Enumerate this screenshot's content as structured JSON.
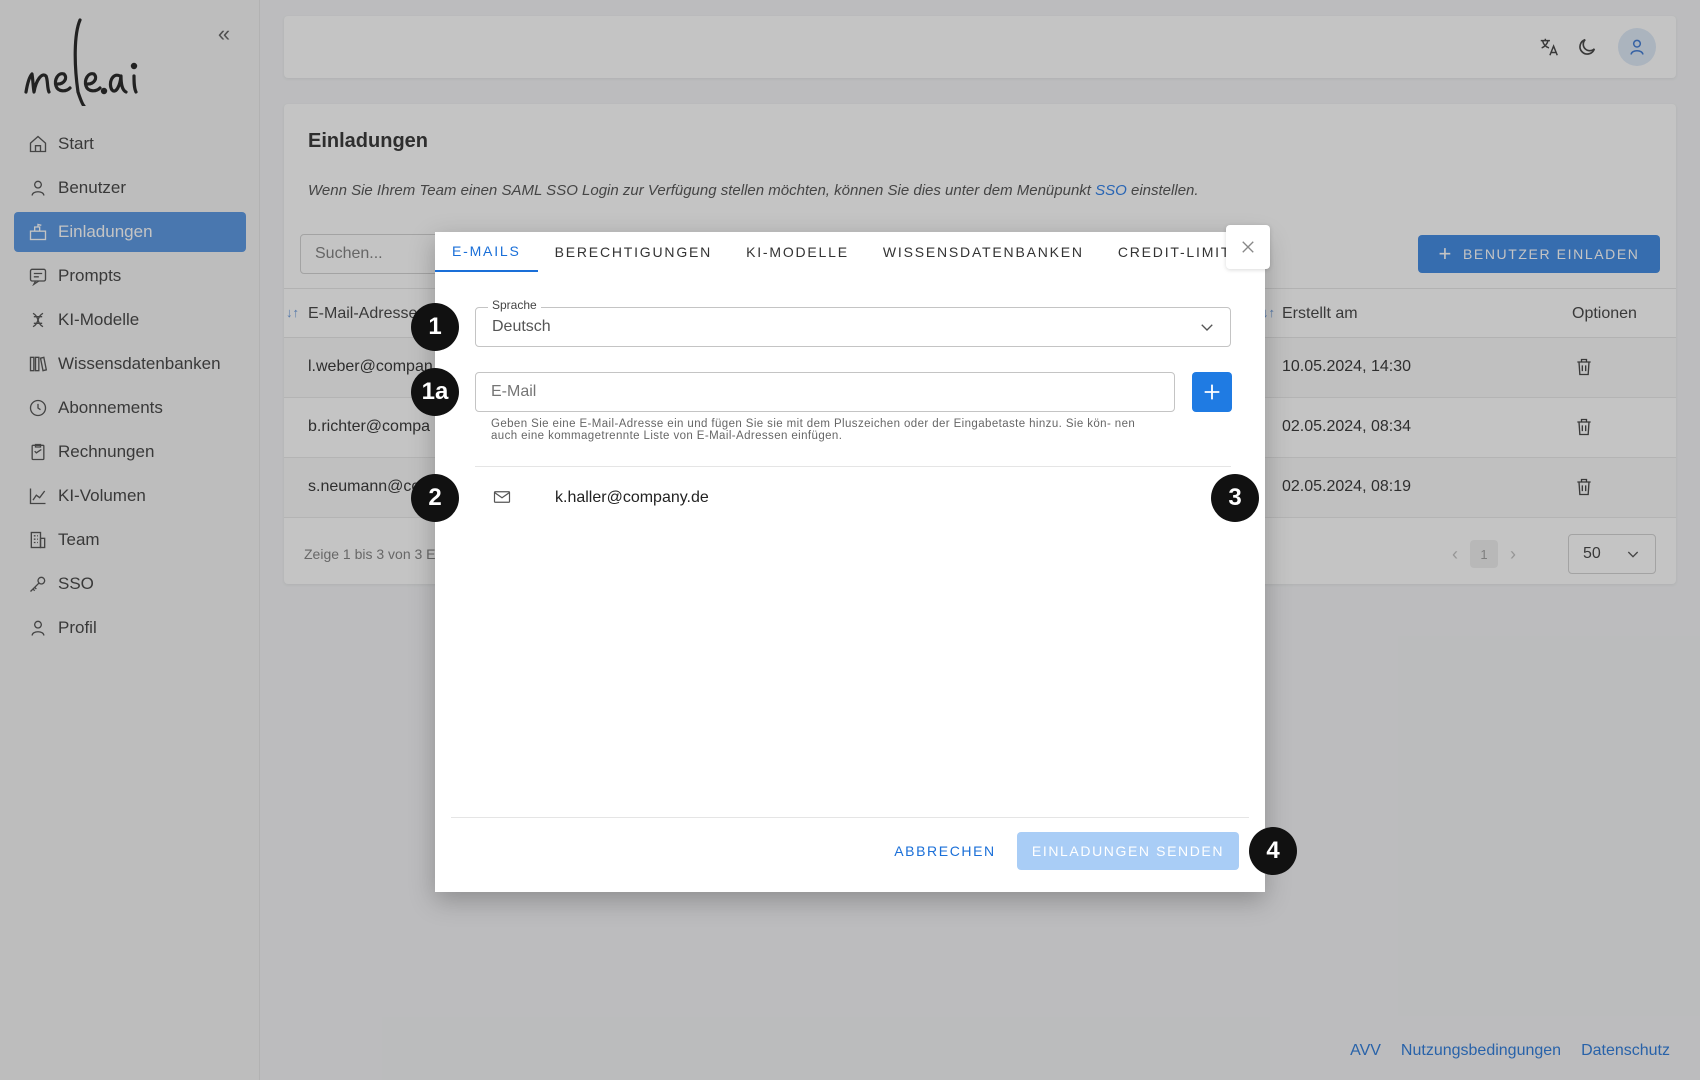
{
  "app": {
    "logo_text": "nele.ai",
    "collapse_icon": "double-chevron-left-icon"
  },
  "sidebar": {
    "items": [
      {
        "label": "Start",
        "icon": "home-icon"
      },
      {
        "label": "Benutzer",
        "icon": "user-icon"
      },
      {
        "label": "Einladungen",
        "icon": "invite-icon",
        "active": true
      },
      {
        "label": "Prompts",
        "icon": "prompt-icon"
      },
      {
        "label": "KI-Modelle",
        "icon": "ai-model-icon"
      },
      {
        "label": "Wissensdatenbanken",
        "icon": "library-icon"
      },
      {
        "label": "Abonnements",
        "icon": "clock-icon"
      },
      {
        "label": "Rechnungen",
        "icon": "invoice-icon"
      },
      {
        "label": "KI-Volumen",
        "icon": "chart-icon"
      },
      {
        "label": "Team",
        "icon": "building-icon"
      },
      {
        "label": "SSO",
        "icon": "key-icon"
      },
      {
        "label": "Profil",
        "icon": "profile-icon"
      }
    ]
  },
  "topbar": {
    "translate_icon": "translate-icon",
    "theme_icon": "moon-icon",
    "avatar_icon": "user-avatar-icon"
  },
  "page": {
    "title": "Einladungen",
    "desc_before": "Wenn Sie Ihrem Team einen SAML SSO Login zur Verfügung stellen möchten, können Sie dies unter dem Menüpunkt ",
    "desc_link": "SSO",
    "desc_after": " einstellen.",
    "search_placeholder": "Suchen...",
    "invite_button": "BENUTZER EINLADEN",
    "columns": {
      "email": "E-Mail-Adresse",
      "created": "Erstellt am",
      "options": "Optionen"
    },
    "rows": [
      {
        "email": "l.weber@compan",
        "created": "10.05.2024, 14:30"
      },
      {
        "email": "b.richter@compa",
        "created": "02.05.2024, 08:34"
      },
      {
        "email": "s.neumann@co",
        "created": "02.05.2024, 08:19"
      }
    ],
    "pagination_text": "Zeige 1 bis 3 von 3 E",
    "current_page": "1",
    "per_page": "50"
  },
  "footer": {
    "links": [
      "AVV",
      "Nutzungsbedingungen",
      "Datenschutz"
    ]
  },
  "modal": {
    "tabs": [
      "E-MAILS",
      "BERECHTIGUNGEN",
      "KI-MODELLE",
      "WISSENSDATENBANKEN",
      "CREDIT-LIMIT"
    ],
    "active_tab": 0,
    "language_label": "Sprache",
    "language_value": "Deutsch",
    "email_placeholder": "E-Mail",
    "helper_text": "Geben Sie eine E-Mail-Adresse ein und fügen Sie sie mit dem Pluszeichen oder der Eingabetaste hinzu. Sie kön- nen auch eine kommagetrennte Liste von E-Mail-Adressen einfügen.",
    "added_emails": [
      "k.haller@company.de"
    ],
    "cancel": "ABBRECHEN",
    "send": "EINLADUNGEN SENDEN"
  },
  "callouts": [
    "1",
    "1a",
    "2",
    "3",
    "4"
  ],
  "colors": {
    "accent": "#1f7be3",
    "active_nav": "#4a8ee0",
    "send_disabled": "#a9cdf6",
    "badge": "#111111"
  }
}
